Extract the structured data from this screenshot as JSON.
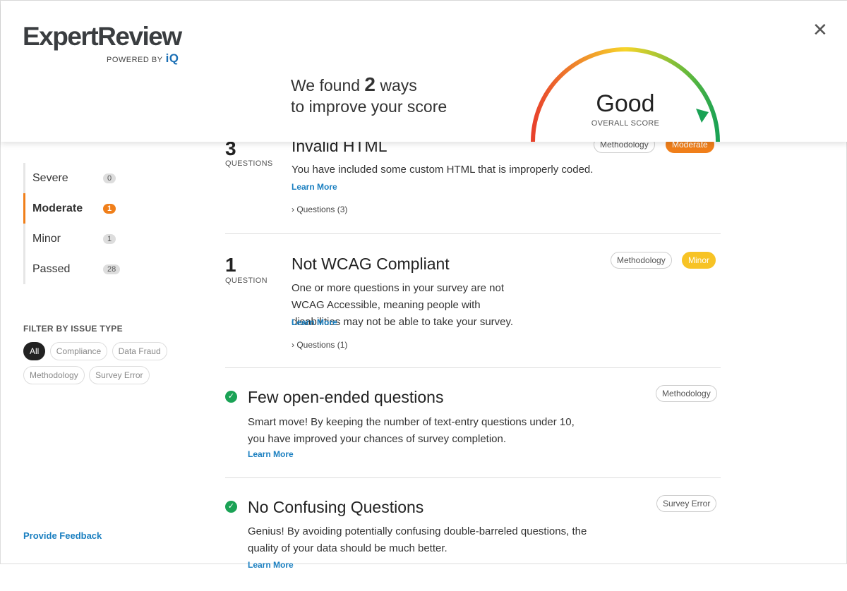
{
  "header": {
    "logo": "ExpertReview",
    "powered_by": "POWERED BY",
    "brand": "iQ",
    "headline_pre": "We found",
    "headline_count": "2",
    "headline_post": "ways",
    "headline_line2": "to improve your score",
    "score": "Good",
    "score_label": "OVERALL SCORE",
    "close_icon": "close-icon"
  },
  "gauge": {
    "colors": [
      "#e8412c",
      "#f7d52a",
      "#1aa255"
    ],
    "level": "Good"
  },
  "sidebar": {
    "items": [
      {
        "label": "Severe",
        "count": "0"
      },
      {
        "label": "Moderate",
        "count": "1"
      },
      {
        "label": "Minor",
        "count": "1"
      },
      {
        "label": "Passed",
        "count": "28"
      }
    ],
    "filter_title": "FILTER BY ISSUE TYPE",
    "filters": [
      "All",
      "Compliance",
      "Data Fraud",
      "Methodology",
      "Survey Error"
    ],
    "feedback": "Provide Feedback"
  },
  "issues": [
    {
      "count": "3",
      "count_label": "QUESTIONS",
      "title": "Invalid HTML",
      "desc": "You have included some custom HTML that is improperly coded.",
      "learn": "Learn More",
      "questions": "Questions (3)",
      "tags": [
        "Methodology",
        "Moderate"
      ]
    },
    {
      "count": "1",
      "count_label": "QUESTION",
      "title": "Not WCAG Compliant",
      "desc": "One or more questions in your survey are not WCAG Accessible, meaning people with disabilities may not be able to take your survey.",
      "learn": "Learn More",
      "questions": "Questions (1)",
      "tags": [
        "Methodology",
        "Minor"
      ]
    },
    {
      "title": "Few open-ended questions",
      "desc": "Smart move! By keeping the number of text-entry questions under 10, you have improved your chances of survey completion.",
      "learn": "Learn More",
      "tags": [
        "Methodology"
      ]
    },
    {
      "title": "No Confusing Questions",
      "desc": "Genius! By avoiding potentially confusing double-barreled questions, the quality of your data should be much better.",
      "learn": "Learn More",
      "tags": [
        "Survey Error"
      ]
    }
  ],
  "colors": {
    "accent": "#f07f1a",
    "minor": "#f7c325",
    "link": "#1a7fc0",
    "pass": "#1aa255"
  }
}
